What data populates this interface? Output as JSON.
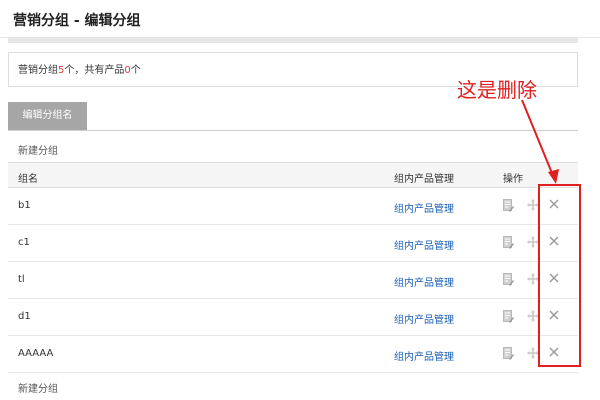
{
  "header": {
    "title": "营销分组 - 编辑分组"
  },
  "summary": {
    "prefix": "营销分组",
    "group_count": "5",
    "middle": "个，共有产品",
    "product_count": "0",
    "suffix": "个"
  },
  "tab": {
    "label": "编辑分组名"
  },
  "actions": {
    "new_group_top": "新建分组",
    "new_group_bottom": "新建分组"
  },
  "table": {
    "columns": {
      "name": "组名",
      "manage": "组内产品管理",
      "ops": "操作"
    },
    "rows": [
      {
        "name": "b1",
        "manage": "组内产品管理"
      },
      {
        "name": "c1",
        "manage": "组内产品管理"
      },
      {
        "name": "tl",
        "manage": "组内产品管理"
      },
      {
        "name": "d1",
        "manage": "组内产品管理"
      },
      {
        "name": "AAAAA",
        "manage": "组内产品管理"
      }
    ],
    "row_icons": [
      "edit-icon",
      "move-icon",
      "delete-icon"
    ]
  },
  "annotation": {
    "text": "这是删除",
    "color": "#e02020"
  },
  "colors": {
    "link": "#1a5fb4",
    "count": "#e4393c",
    "tab_bg": "#a6a6a6"
  }
}
